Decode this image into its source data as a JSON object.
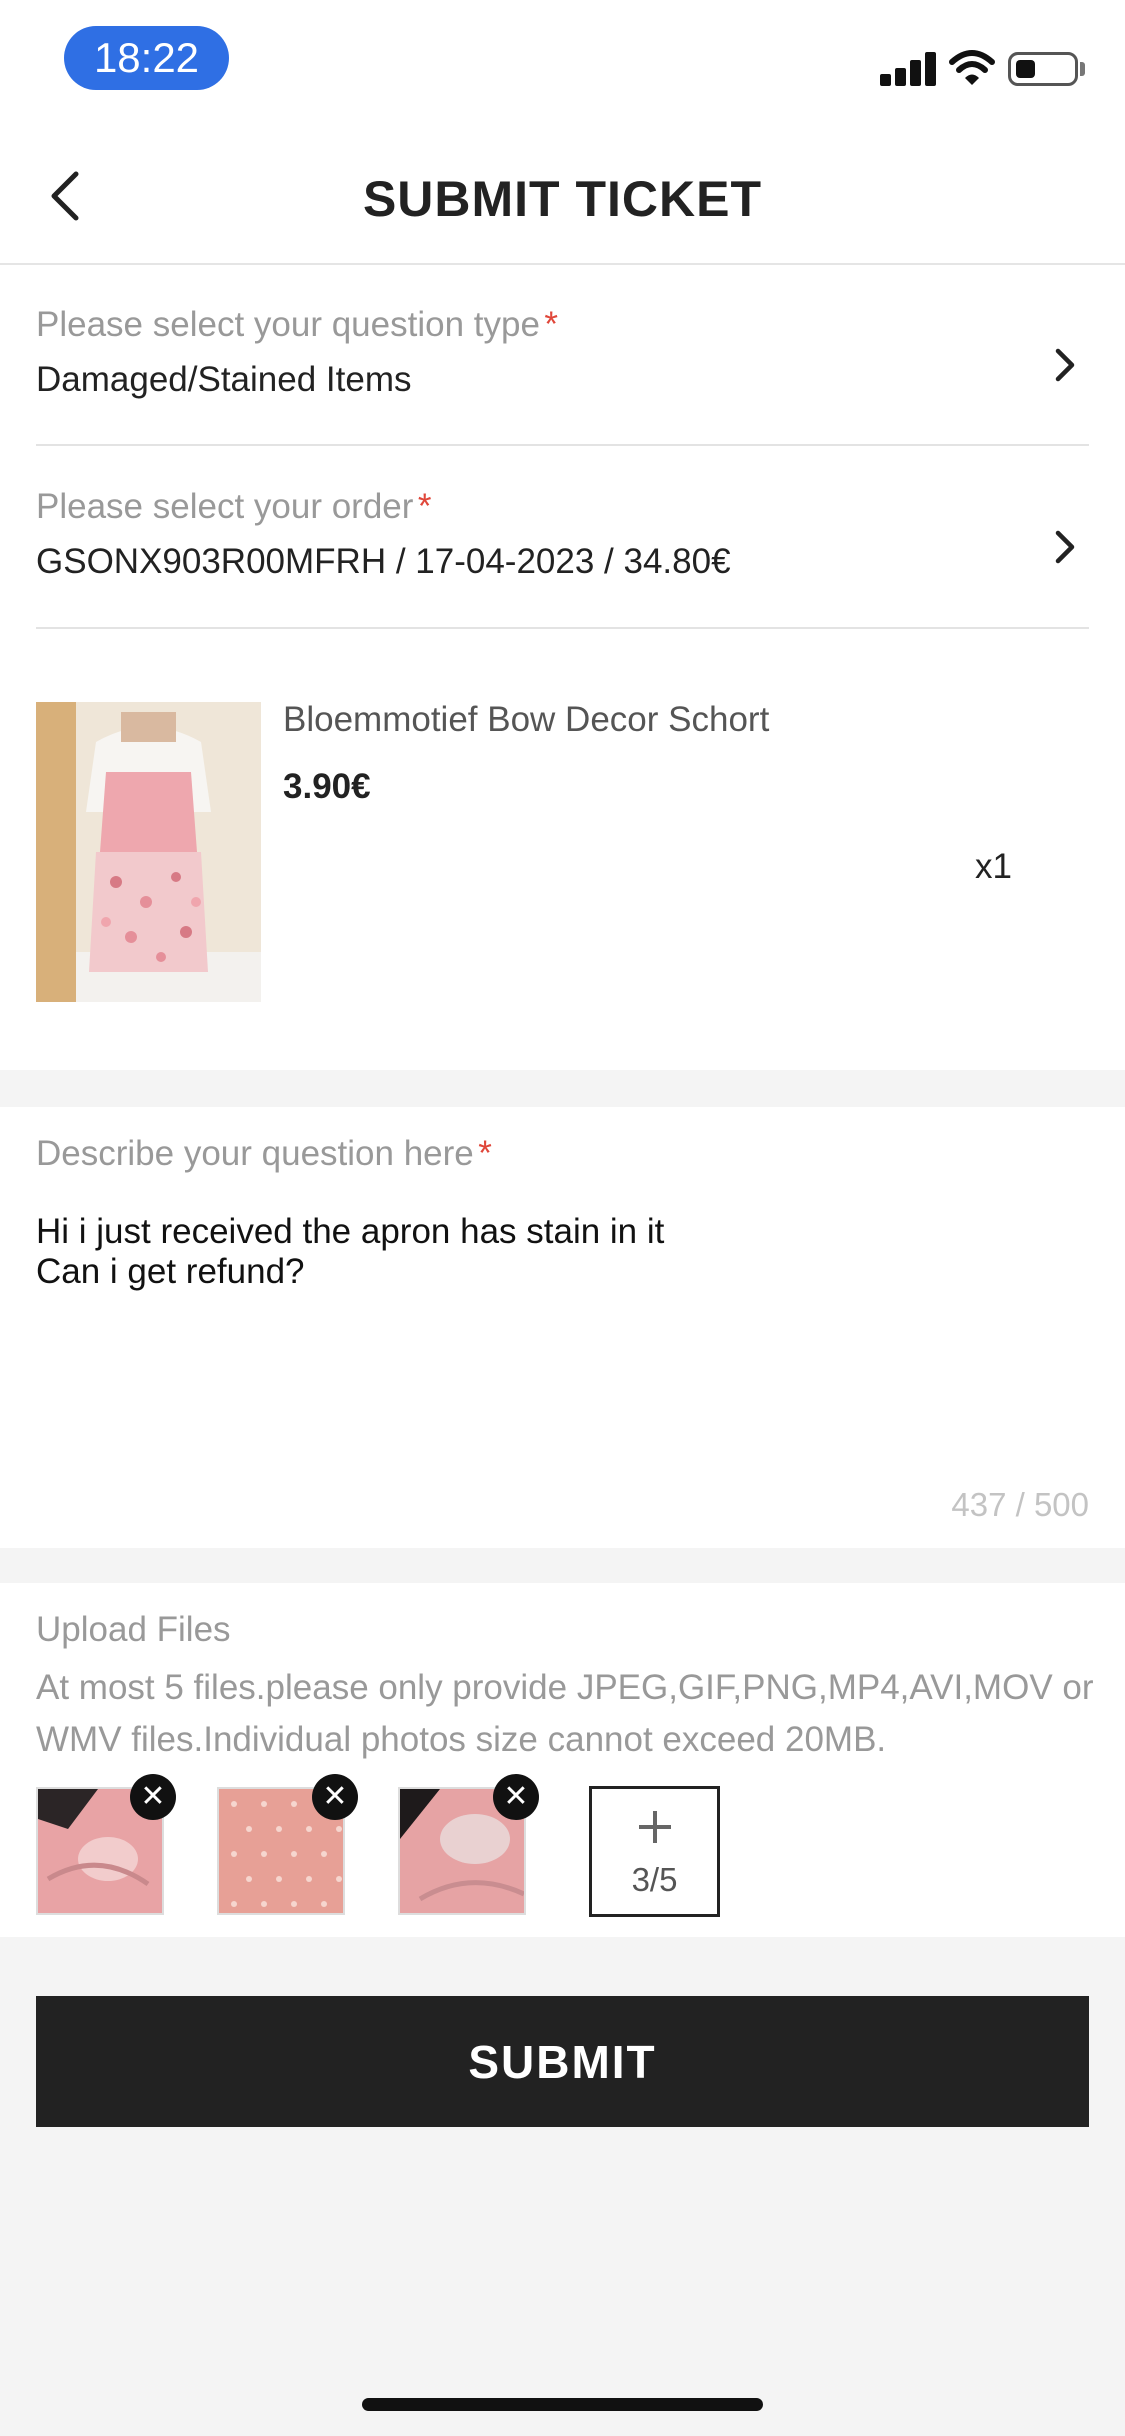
{
  "status_bar": {
    "time": "18:22",
    "battery_level": 0.35
  },
  "header": {
    "title": "SUBMIT TICKET",
    "back_icon": "chevron-left-icon"
  },
  "form": {
    "question_type": {
      "label": "Please select your question type",
      "required": "*",
      "value": "Damaged/Stained Items"
    },
    "order": {
      "label": "Please select your order",
      "required": "*",
      "value": "GSONX903R00MFRH / 17-04-2023 / 34.80€"
    },
    "product": {
      "name": "Bloemmotief Bow Decor Schort",
      "price": "3.90€",
      "quantity": "x1"
    },
    "description": {
      "label": "Describe your question here",
      "required": "*",
      "value": "Hi i just received the apron has stain in it\nCan i get refund?",
      "counter": "437 / 500"
    },
    "upload": {
      "title": "Upload Files",
      "hint": "At most 5 files.please only provide JPEG,GIF,PNG,MP4,AVI,MOV or WMV files.Individual photos size cannot exceed 20MB.",
      "count_label": "3/5",
      "add_icon": "plus-icon",
      "remove_icon": "close-icon"
    },
    "submit_label": "SUBMIT"
  },
  "colors": {
    "accent_required": "#e0473a",
    "button": "#222222",
    "time_pill": "#2f6fe4"
  }
}
